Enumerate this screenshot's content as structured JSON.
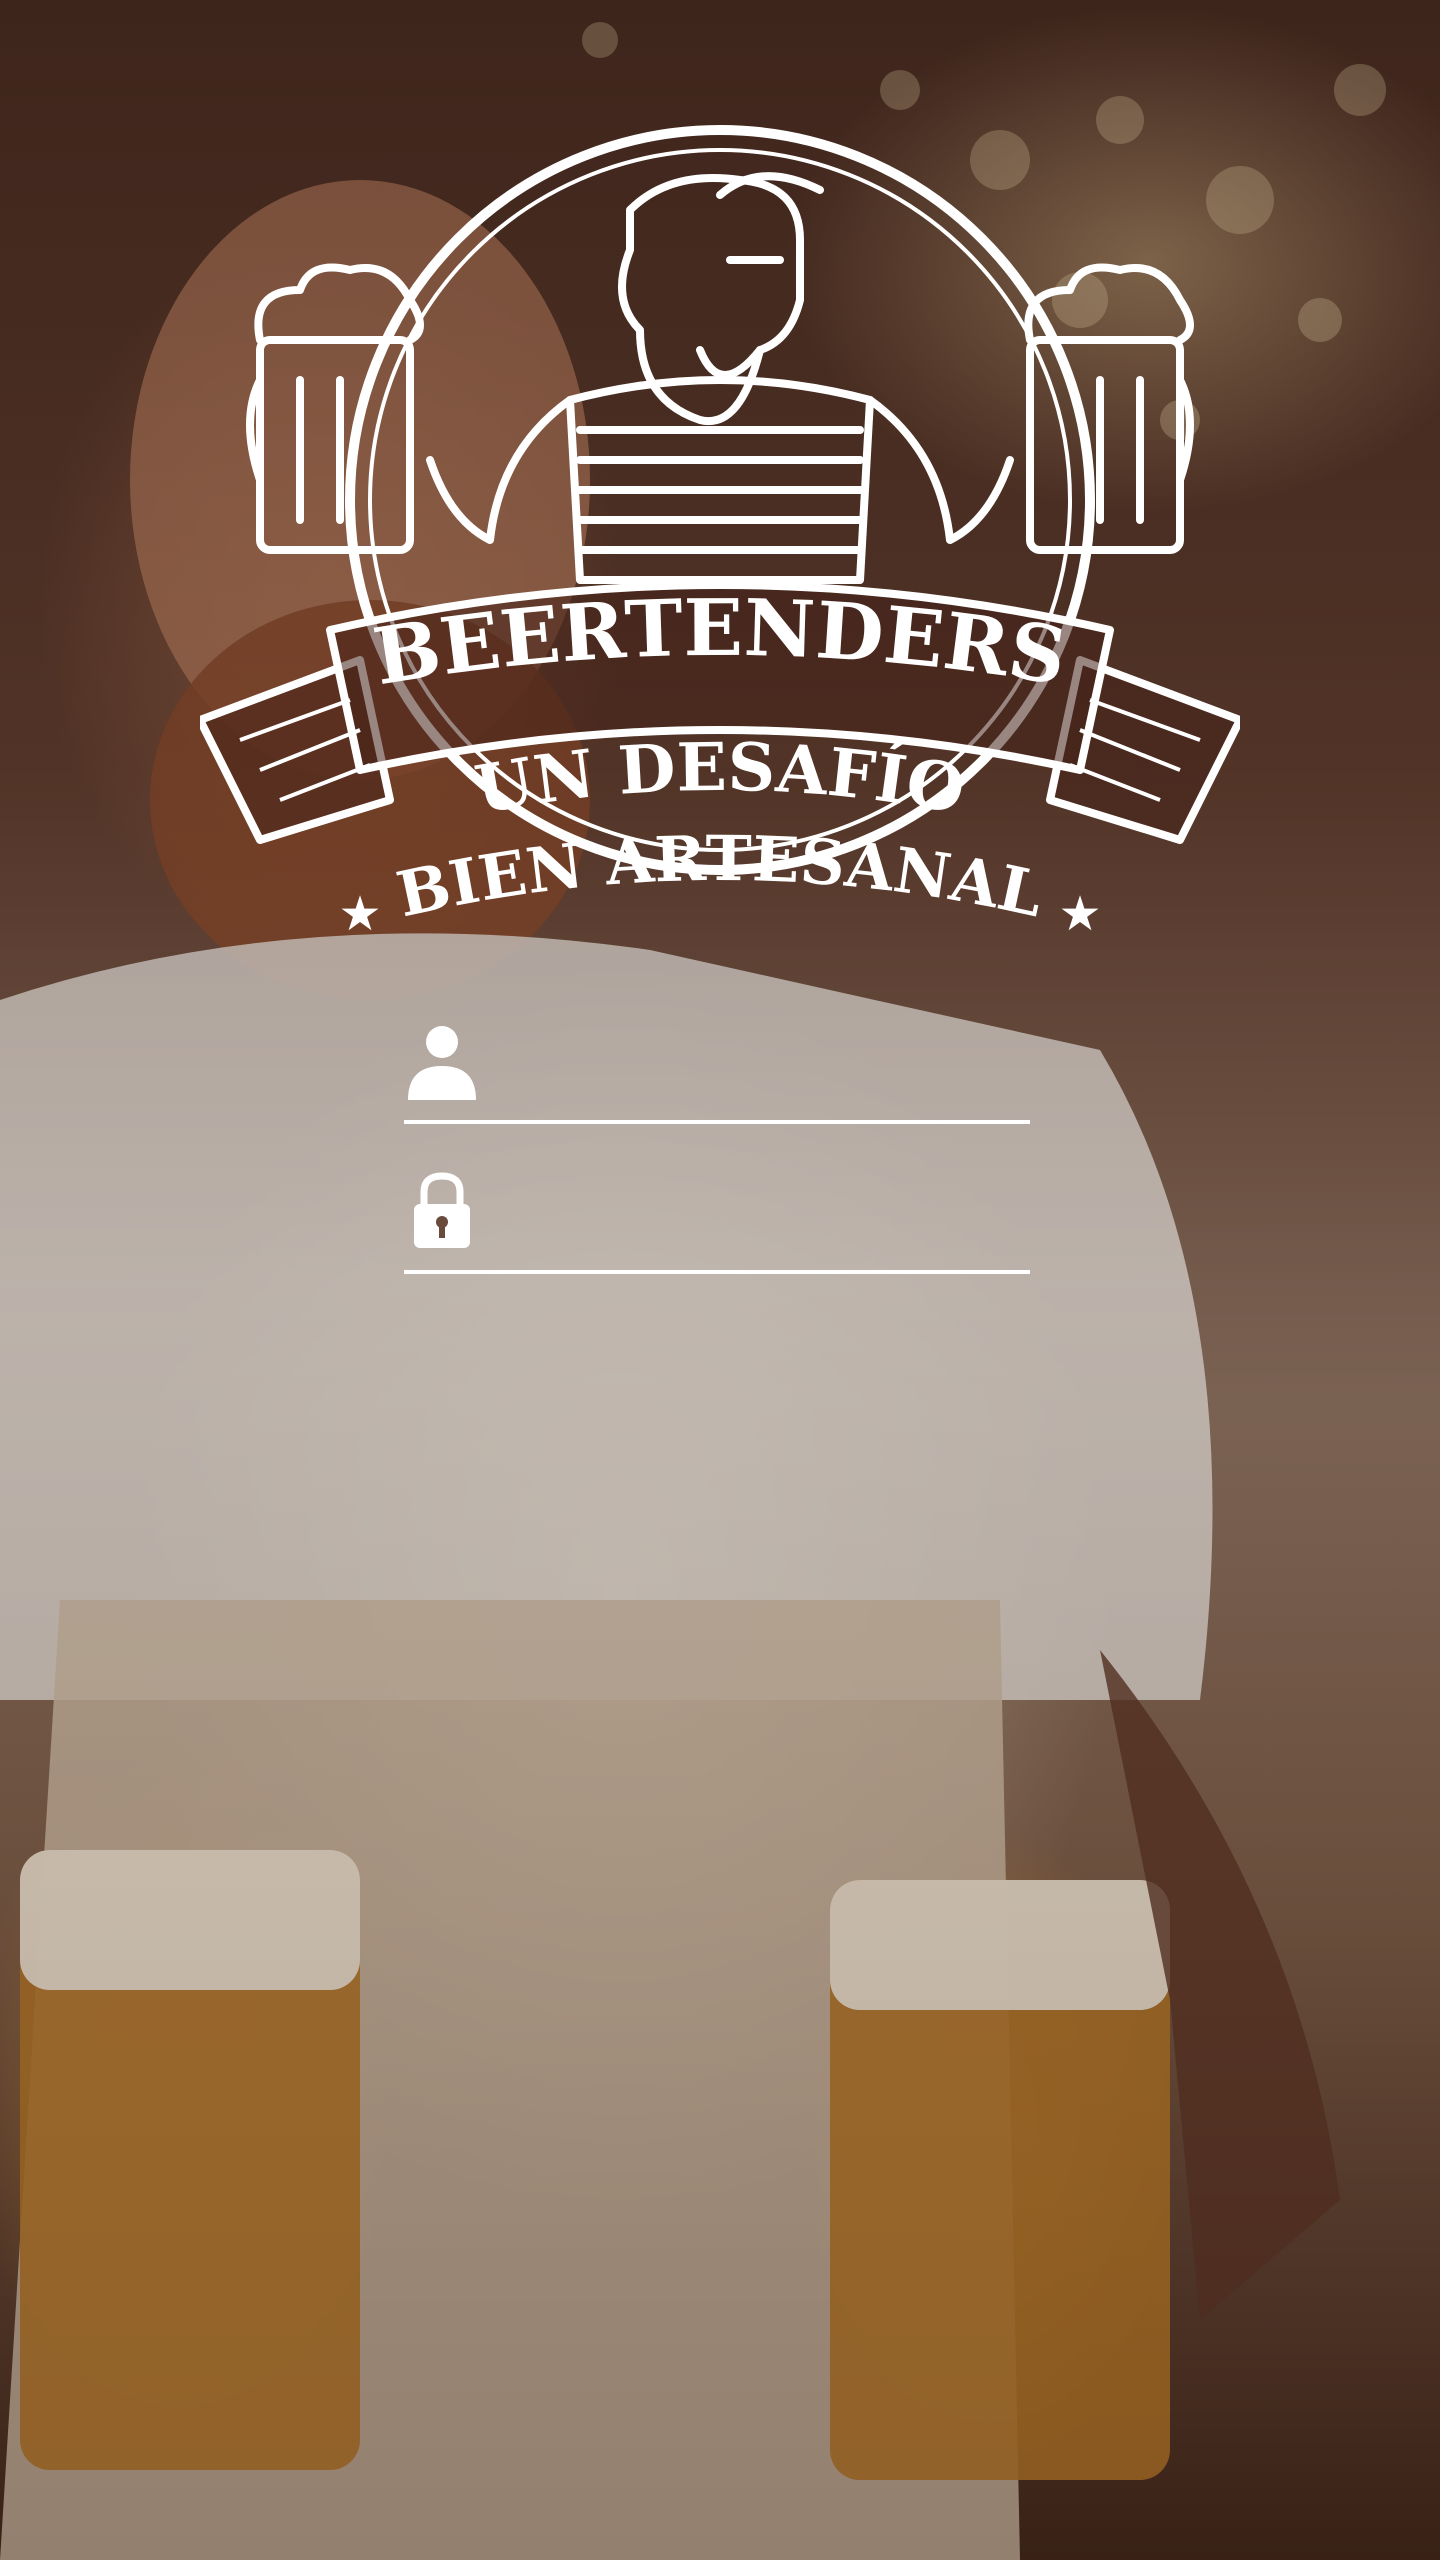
{
  "logo": {
    "title": "BEERTENDERS",
    "line1": "UN DESAFÍO",
    "line2": "BIEN ARTESANAL",
    "star": "★"
  },
  "login": {
    "username": {
      "icon": "user-icon",
      "value": "",
      "placeholder": ""
    },
    "password": {
      "icon": "lock-icon",
      "value": "",
      "placeholder": ""
    }
  },
  "colors": {
    "text": "#ffffff"
  }
}
